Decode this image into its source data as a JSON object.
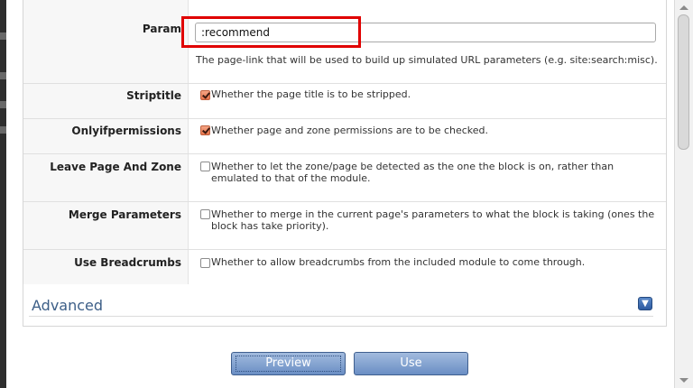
{
  "form": {
    "rows": [
      {
        "label": "Param",
        "value": ":recommend",
        "description": "The page-link that will be used to build up simulated URL parameters (e.g. site:search:misc)."
      },
      {
        "label": "Striptitle",
        "checked": true,
        "description": "Whether the page title is to be stripped."
      },
      {
        "label": "Onlyifpermissions",
        "checked": true,
        "description": "Whether page and zone permissions are to be checked."
      },
      {
        "label": "Leave Page And Zone",
        "checked": false,
        "description": "Whether to let the zone/page be detected as the one the block is on, rather than emulated to that of the module."
      },
      {
        "label": "Merge Parameters",
        "checked": false,
        "description": "Whether to merge in the current page's parameters to what the block is taking (ones the block has take priority)."
      },
      {
        "label": "Use Breadcrumbs",
        "checked": false,
        "description": "Whether to allow breadcrumbs from the included module to come through."
      }
    ]
  },
  "advanced": {
    "title": "Advanced",
    "icon": "expand-chevron-icon"
  },
  "buttons": {
    "preview_label": "Preview",
    "use_label": "Use"
  },
  "colors": {
    "highlight": "#e00000",
    "button": "#6a8ec4",
    "checkbox_checked": "#e8744b",
    "advanced_title": "#3c5e87"
  }
}
